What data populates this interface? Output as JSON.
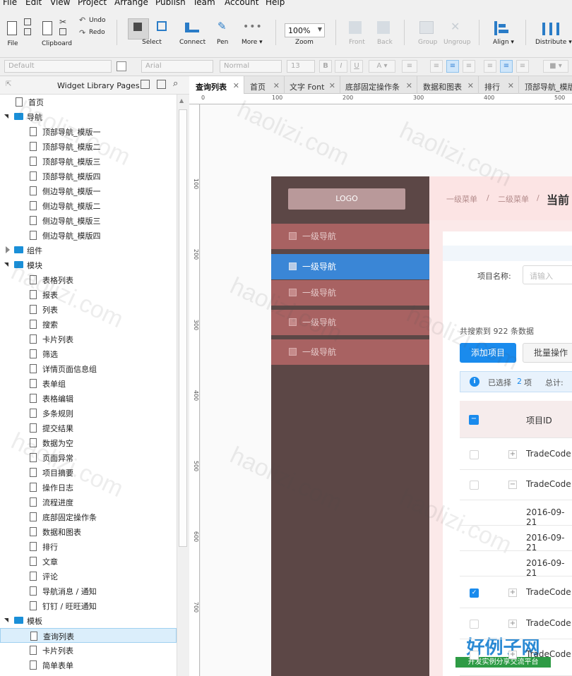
{
  "menu": [
    "File",
    "Edit",
    "View",
    "Project",
    "Arrange",
    "Publish",
    "Team",
    "Account",
    "Help"
  ],
  "toolbar": {
    "file": "File",
    "clipboard": "Clipboard",
    "undo": "Undo",
    "redo": "Redo",
    "select": "Select",
    "connect": "Connect",
    "pen": "Pen",
    "more": "More ▾",
    "zoom_value": "100%",
    "zoom": "Zoom",
    "front": "Front",
    "back": "Back",
    "group": "Group",
    "ungroup": "Ungroup",
    "align": "Align ▾",
    "distribute": "Distribute ▾"
  },
  "format": {
    "style": "Default",
    "font": "Arial",
    "weight": "Normal",
    "size": "13"
  },
  "pages_panel": {
    "title": "Widget Library Pages",
    "tree": [
      {
        "label": "首页",
        "type": "page",
        "level": 1
      },
      {
        "label": "导航",
        "type": "folder",
        "level": 0,
        "open": true
      },
      {
        "label": "顶部导航_模版一",
        "type": "page",
        "level": 2
      },
      {
        "label": "顶部导航_模版二",
        "type": "page",
        "level": 2
      },
      {
        "label": "顶部导航_模版三",
        "type": "page",
        "level": 2
      },
      {
        "label": "顶部导航_模版四",
        "type": "page",
        "level": 2
      },
      {
        "label": "侧边导航_模版一",
        "type": "page",
        "level": 2
      },
      {
        "label": "侧边导航_模版二",
        "type": "page",
        "level": 2
      },
      {
        "label": "侧边导航_模版三",
        "type": "page",
        "level": 2
      },
      {
        "label": "侧边导航_模版四",
        "type": "page",
        "level": 2
      },
      {
        "label": "组件",
        "type": "folder",
        "level": 0,
        "open": false
      },
      {
        "label": "模块",
        "type": "folder",
        "level": 0,
        "open": true
      },
      {
        "label": "表格列表",
        "type": "page",
        "level": 2
      },
      {
        "label": "报表",
        "type": "page",
        "level": 2
      },
      {
        "label": "列表",
        "type": "page",
        "level": 2
      },
      {
        "label": "搜索",
        "type": "page",
        "level": 2
      },
      {
        "label": "卡片列表",
        "type": "page",
        "level": 2
      },
      {
        "label": "筛选",
        "type": "page",
        "level": 2
      },
      {
        "label": "详情页面信息组",
        "type": "page",
        "level": 2
      },
      {
        "label": "表单组",
        "type": "page",
        "level": 2
      },
      {
        "label": "表格编辑",
        "type": "page",
        "level": 2
      },
      {
        "label": "多条规则",
        "type": "page",
        "level": 2
      },
      {
        "label": "提交结果",
        "type": "page",
        "level": 2
      },
      {
        "label": "数据为空",
        "type": "page",
        "level": 2
      },
      {
        "label": "页面异常",
        "type": "page",
        "level": 2
      },
      {
        "label": "项目摘要",
        "type": "page",
        "level": 2
      },
      {
        "label": "操作日志",
        "type": "page",
        "level": 2
      },
      {
        "label": "流程进度",
        "type": "page",
        "level": 2
      },
      {
        "label": "底部固定操作条",
        "type": "page",
        "level": 2
      },
      {
        "label": "数据和图表",
        "type": "page",
        "level": 2
      },
      {
        "label": "排行",
        "type": "page",
        "level": 2
      },
      {
        "label": "文章",
        "type": "page",
        "level": 2
      },
      {
        "label": "评论",
        "type": "page",
        "level": 2
      },
      {
        "label": "导航消息 / 通知",
        "type": "page",
        "level": 2
      },
      {
        "label": "钉钉 / 旺旺通知",
        "type": "page",
        "level": 2
      },
      {
        "label": "模板",
        "type": "folder",
        "level": 0,
        "open": true
      },
      {
        "label": "查询列表",
        "type": "page",
        "level": 2,
        "selected": true
      },
      {
        "label": "卡片列表",
        "type": "page",
        "level": 2
      },
      {
        "label": "简单表单",
        "type": "page",
        "level": 2
      }
    ]
  },
  "tabs": [
    "查询列表",
    "首页",
    "文字 Font",
    "底部固定操作条",
    "数据和图表",
    "排行",
    "顶部导航_模版"
  ],
  "ruler_h": [
    "0",
    "100",
    "200",
    "300",
    "400",
    "500"
  ],
  "ruler_v": [
    "100",
    "200",
    "300",
    "400",
    "500",
    "600",
    "700"
  ],
  "design": {
    "logo": "LOGO",
    "nav": [
      "一级导航",
      "一级导航",
      "一级导航",
      "一级导航",
      "一级导航"
    ],
    "breadcrumb": [
      "一级菜单",
      "/",
      "二级菜单",
      "/",
      "当前"
    ],
    "project_name_label": "项目名称:",
    "project_name_placeholder": "请输入",
    "result_count": "共搜索到 922 条数据",
    "add_button": "添加项目",
    "batch_button": "批量操作",
    "selected_info": "已选择 2 项",
    "selected_prefix": "已选择",
    "selected_num": "2",
    "selected_suffix": "项",
    "total_label": "总计:",
    "column_id": "项目ID",
    "rows": [
      "TradeCode",
      "TradeCode",
      "2016-09-21",
      "2016-09-21",
      "2016-09-21",
      "TradeCode",
      "TradeCode",
      "TradeCode"
    ]
  },
  "watermark": {
    "text": "haolizi.com",
    "brand": "好例子网",
    "slogan": "开发实例分享交流平台"
  }
}
